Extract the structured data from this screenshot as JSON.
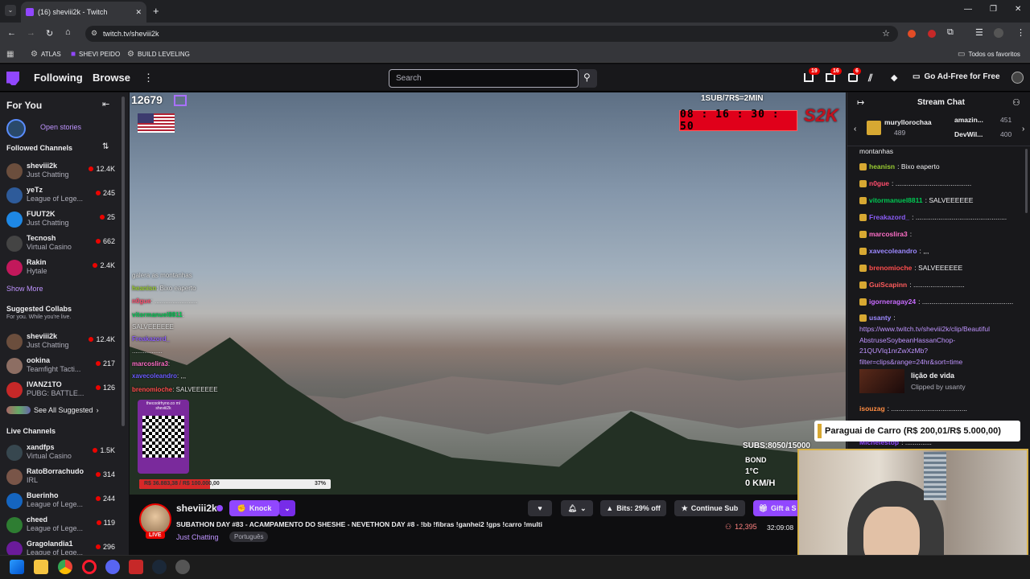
{
  "browser": {
    "tab_title": "(16) sheviii2k - Twitch",
    "url": "twitch.tv/sheviii2k",
    "bookmarks": [
      "ATLAS",
      "SHEVI PEIDO",
      "BUILD LEVELING"
    ],
    "all_bookmarks": "Todos os favoritos"
  },
  "nav": {
    "following": "Following",
    "browse": "Browse",
    "search_placeholder": "Search",
    "badges": [
      "19",
      "16",
      "6"
    ],
    "ad_free": "Go Ad-Free for Free"
  },
  "sidebar": {
    "for_you": "For You",
    "open_stories": "Open stories",
    "followed_title": "Followed Channels",
    "followed": [
      {
        "name": "sheviii2k",
        "category": "Just Chatting",
        "viewers": "12.4K"
      },
      {
        "name": "yeTz",
        "category": "League of Lege...",
        "viewers": "245"
      },
      {
        "name": "FUUT2K",
        "category": "Just Chatting",
        "viewers": "25"
      },
      {
        "name": "Tecnosh",
        "category": "Virtual Casino",
        "viewers": "662"
      },
      {
        "name": "Rakin",
        "category": "Hytale",
        "viewers": "2.4K"
      }
    ],
    "show_more": "Show More",
    "collabs_title": "Suggested Collabs",
    "collabs_sub": "For you. While you're live.",
    "collabs": [
      {
        "name": "sheviii2k",
        "category": "Just Chatting",
        "viewers": "12.4K"
      },
      {
        "name": "ookina",
        "category": "Teamfight Tacti...",
        "viewers": "217"
      },
      {
        "name": "IVANZ1TO",
        "category": "PUBG: BATTLE...",
        "viewers": "126"
      }
    ],
    "see_all": "See All Suggested",
    "live_title": "Live Channels",
    "live": [
      {
        "name": "xandfps",
        "category": "Virtual Casino",
        "viewers": "1.5K"
      },
      {
        "name": "RatoBorrachudo",
        "category": "IRL",
        "viewers": "314"
      },
      {
        "name": "Buerinho",
        "category": "League of Lege...",
        "viewers": "244"
      },
      {
        "name": "cheed",
        "category": "League of Lege...",
        "viewers": "119"
      },
      {
        "name": "Gragolandia1",
        "category": "League of Lege...",
        "viewers": "296"
      }
    ]
  },
  "video": {
    "viewer_overlay": "12679",
    "sub_rate": "1SUB/7R$=2MIN",
    "timer": "08 : 16 : 30 : 50",
    "subs": "SUBS:8050/15000",
    "bond": "BOND",
    "temp": "1°C",
    "speed": "0 KM/H",
    "goal_bar": "R$ 36.883,38 / R$ 100.000,00",
    "goal_pct": "37%",
    "goal_progress": 0.37,
    "qr_title": "thecoolrhyno.co m/ sheviii2k",
    "overlay_chat": [
      {
        "user": "",
        "text": "galera as montanhas"
      },
      {
        "user": "heanisn",
        "text": ": Bixo eaperto"
      },
      {
        "user": "n0gue",
        "text": ": ........................"
      },
      {
        "user": "vitormanuel8811",
        "text": ":"
      },
      {
        "user": "",
        "text": "SALVEEEEEE"
      },
      {
        "user": "Freakazord_",
        "text": ""
      },
      {
        "user": "",
        "text": "................."
      },
      {
        "user": "marcoslira3",
        "text": ":"
      },
      {
        "user": "xavecoleandro",
        "text": ": ,,,"
      },
      {
        "user": "brenomioche",
        "text": ": SALVEEEEEE"
      }
    ]
  },
  "stream_info": {
    "channel": "sheviii2k",
    "knock": "Knock",
    "bits": "Bits: 29% off",
    "continue_sub": "Continue Sub",
    "gift": "Gift a S",
    "title": "SUBATHON DAY #83 - ACAMPAMENTO DO SHESHE - NEVETHON DAY #8 - !bb !fibras !ganhei2 !gps !carro !multi",
    "category": "Just Chatting",
    "tag": "Português",
    "viewers": "12,395",
    "uptime": "32:09:08",
    "live": "LIVE"
  },
  "chat": {
    "title": "Stream Chat",
    "gifter_left": {
      "name": "muryllorochaa",
      "count": "489"
    },
    "gifter_right": [
      {
        "name": "amazin...",
        "count": "451"
      },
      {
        "name": "DevWil...",
        "count": "400"
      }
    ],
    "top_cut": "montanhas",
    "messages": [
      {
        "user": "heanisn",
        "text": ": Bixo eaperto",
        "color": "#9acd32"
      },
      {
        "user": "n0gue",
        "text": ": ........................................",
        "color": "#ff4d6d"
      },
      {
        "user": "vitormanuel8811",
        "text": ": SALVEEEEEE",
        "color": "#00c853"
      },
      {
        "user": "Freakazord_",
        "text": ": ................................................",
        "color": "#8a5cf6"
      },
      {
        "user": "marcoslira3",
        "text": ":",
        "color": "#ff6ec7"
      },
      {
        "user": "xavecoleandro",
        "text": ": ,,,",
        "color": "#9c88ff"
      },
      {
        "user": "brenomioche",
        "text": ": SALVEEEEEE",
        "color": "#ff4d4d"
      },
      {
        "user": "GuiScapinn",
        "text": ": ...........................",
        "color": "#ff5c5c"
      },
      {
        "user": "igorneragay24",
        "text": ": ................................................",
        "color": "#c86bff"
      },
      {
        "user": "usanty",
        "text": ":",
        "color": "#9c88ff"
      }
    ],
    "link": "https://www.twitch.tv/sheviii2k/clip/BeautifulAbstruseSoybeanHassanChop-21QUVIq1nrZwXzMb?filter=clips&range=24hr&sort=time",
    "link_lines": [
      "https://www.twitch.tv/sheviii2k/clip/Beautiful",
      "AbstruseSoybeanHassanChop-",
      "21QUVIq1nrZwXzMb?",
      "filter=clips&range=24hr&sort=time"
    ],
    "clip_title": "lição de vida",
    "clip_by": "Clipped by usanty",
    "isouzag": "isouzag",
    "isouzag_text": ": ........................................",
    "bottom_cut": "Michelestop",
    "bottom_cut_text": ": ..............",
    "donation": "Paraguai de Carro (R$ 200,01/R$ 5.000,00)"
  },
  "colors": {
    "accent": "#9147ff",
    "live": "#eb0400",
    "link": "#bf94ff"
  }
}
